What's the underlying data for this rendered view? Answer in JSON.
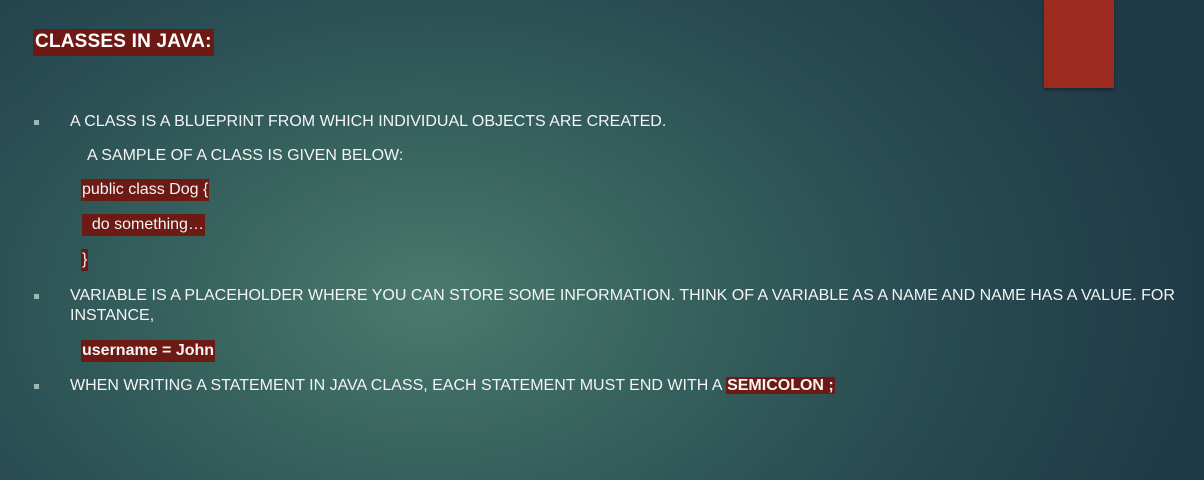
{
  "slide": {
    "title": "CLASSES IN JAVA:",
    "bullets": [
      {
        "text": "A CLASS IS A BLUEPRINT FROM WHICH INDIVIDUAL OBJECTS ARE CREATED."
      },
      {
        "text": "VARIABLE IS A PLACEHOLDER WHERE YOU CAN STORE  SOME INFORMATION. THINK OF A VARIABLE AS A NAME AND NAME HAS A VALUE.  FOR INSTANCE,"
      },
      {
        "text_prefix": "WHEN WRITING A STATEMENT IN JAVA CLASS, EACH STATEMENT MUST END WITH A ",
        "highlight": "SEMICOLON ;"
      }
    ],
    "sample_intro": "A SAMPLE OF A CLASS IS GIVEN BELOW:",
    "code_sample": {
      "line1": "public class Dog {",
      "line2": "  do something…",
      "line3": "}"
    },
    "variable_example": "username = John"
  },
  "colors": {
    "highlight": "#6d1a14",
    "accent": "#9c2a1f",
    "background": "#35605c"
  }
}
